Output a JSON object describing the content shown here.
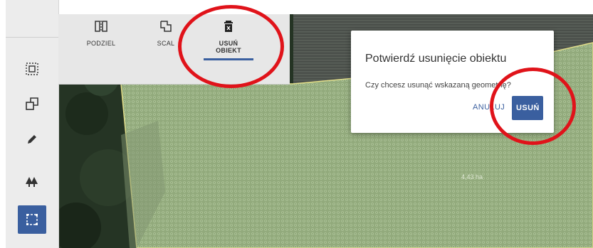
{
  "sidebar": {
    "items": [
      {
        "icon": "select-area-icon"
      },
      {
        "icon": "copy-icon"
      },
      {
        "icon": "pencil-icon"
      },
      {
        "icon": "trees-icon"
      },
      {
        "icon": "frame-select-icon",
        "active": true
      }
    ]
  },
  "toolbar": {
    "split_label": "PODZIEL",
    "merge_label": "SCAL",
    "delete_label_line1": "USUŃ",
    "delete_label_line2": "OBIEKT"
  },
  "dialog": {
    "title": "Potwierdź usunięcie obiektu",
    "message": "Czy chcesz usunąć wskazaną geometrię?",
    "cancel_label": "ANULUJ",
    "confirm_label": "USUŃ"
  },
  "map": {
    "area_label": "4,43 ha"
  },
  "colors": {
    "accent": "#3a5f9f",
    "highlight_circle": "#e0131a",
    "parcel_fill": "#9bb483",
    "parcel_border": "#e6e088"
  }
}
